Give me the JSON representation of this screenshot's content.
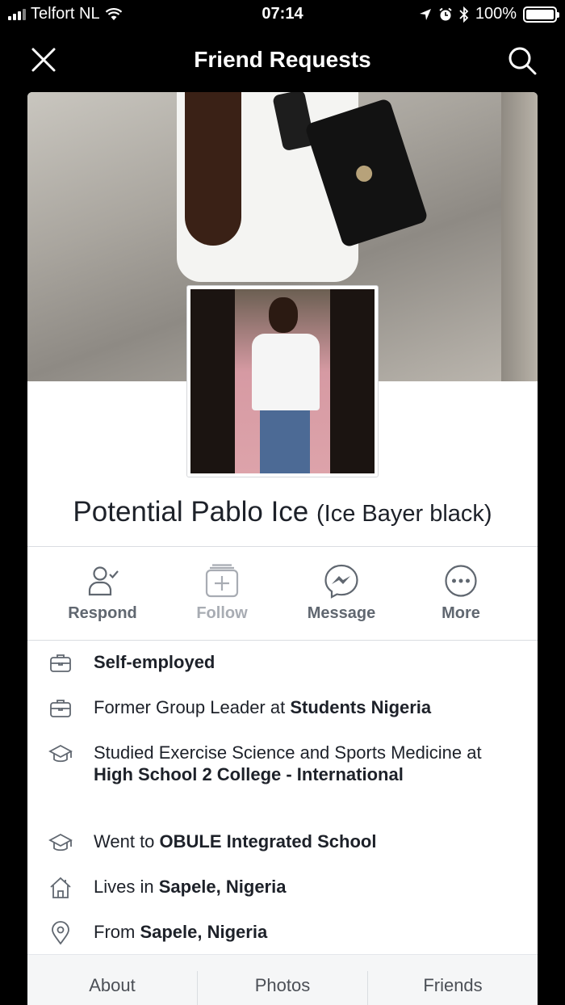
{
  "status_bar": {
    "carrier": "Telfort NL",
    "time": "07:14",
    "battery": "100%",
    "battery_level": 1.0
  },
  "nav": {
    "title": "Friend Requests",
    "close_icon": "close-icon",
    "search_icon": "search-icon"
  },
  "profile": {
    "name": "Potential Pablo Ice",
    "alternate_name": "(Ice Bayer black)"
  },
  "actions": [
    {
      "label": "Respond",
      "icon": "person-check-icon",
      "enabled": true
    },
    {
      "label": "Follow",
      "icon": "follow-plus-icon",
      "enabled": false
    },
    {
      "label": "Message",
      "icon": "messenger-icon",
      "enabled": true
    },
    {
      "label": "More",
      "icon": "more-dots-icon",
      "enabled": true
    }
  ],
  "info": {
    "work1": {
      "bold": "Self-employed"
    },
    "work2": {
      "prefix": "Former Group Leader at ",
      "bold": "Students Nigeria"
    },
    "edu1": {
      "prefix": "Studied Exercise Science and Sports Medicine at ",
      "bold": "High School 2 College - International"
    },
    "edu2": {
      "prefix": "Went to ",
      "bold": "OBULE Integrated School"
    },
    "home": {
      "prefix": "Lives in ",
      "bold": "Sapele, Nigeria"
    },
    "origin": {
      "prefix": "From ",
      "bold": "Sapele, Nigeria"
    }
  },
  "tabs": [
    "About",
    "Photos",
    "Friends"
  ],
  "colors": {
    "background": "#000000",
    "card": "#ffffff",
    "text": "#1d2129",
    "secondary_text": "#606770",
    "disabled_text": "#a8acb3",
    "tab_bar": "#f5f6f7"
  }
}
